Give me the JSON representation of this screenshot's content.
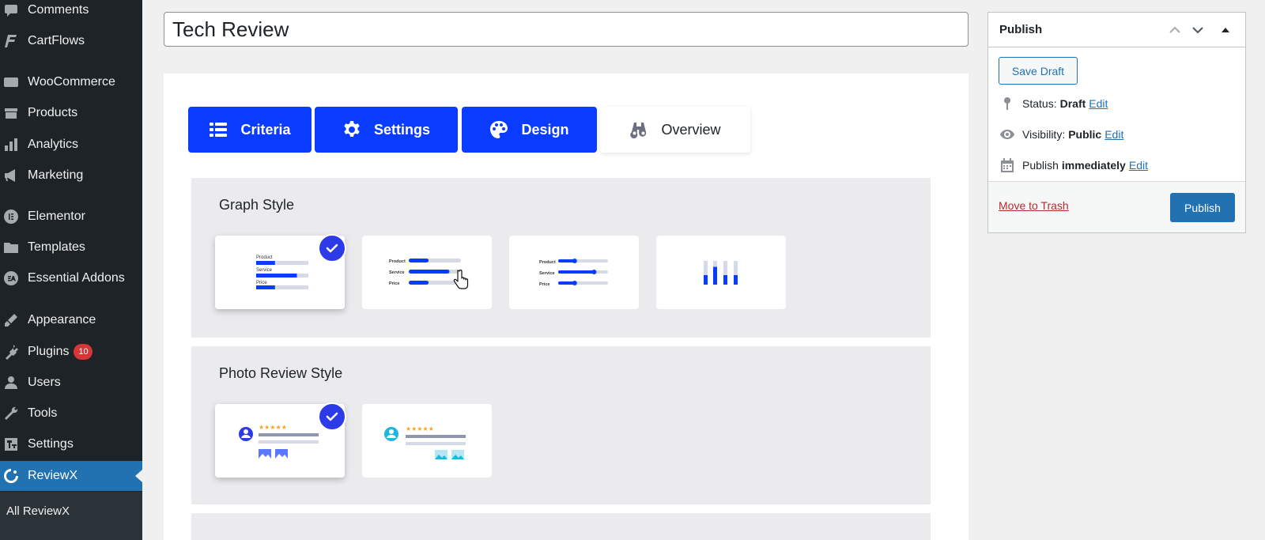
{
  "sidebar": {
    "items": [
      {
        "label": "Comments",
        "icon": "comments-icon"
      },
      {
        "label": "CartFlows",
        "icon": "cartflows-icon"
      },
      {
        "label": "WooCommerce",
        "icon": "woocommerce-icon"
      },
      {
        "label": "Products",
        "icon": "products-icon"
      },
      {
        "label": "Analytics",
        "icon": "analytics-icon"
      },
      {
        "label": "Marketing",
        "icon": "marketing-icon"
      },
      {
        "label": "Elementor",
        "icon": "elementor-icon"
      },
      {
        "label": "Templates",
        "icon": "templates-icon"
      },
      {
        "label": "Essential Addons",
        "icon": "essential-addons-icon"
      },
      {
        "label": "Appearance",
        "icon": "appearance-icon"
      },
      {
        "label": "Plugins",
        "icon": "plugins-icon",
        "badge": "10"
      },
      {
        "label": "Users",
        "icon": "users-icon"
      },
      {
        "label": "Tools",
        "icon": "tools-icon"
      },
      {
        "label": "Settings",
        "icon": "settings-icon"
      },
      {
        "label": "ReviewX",
        "icon": "reviewx-icon",
        "active": true
      }
    ],
    "submenu": {
      "label": "All ReviewX"
    }
  },
  "post": {
    "title": "Tech Review"
  },
  "tabs": [
    {
      "label": "Criteria",
      "icon": "list-icon"
    },
    {
      "label": "Settings",
      "icon": "gear-icon"
    },
    {
      "label": "Design",
      "icon": "palette-icon"
    },
    {
      "label": "Overview",
      "icon": "binoculars-icon"
    }
  ],
  "graph_style": {
    "title": "Graph Style",
    "options": [
      {
        "name": "style-1",
        "selected": true,
        "labels": [
          "Product",
          "Service",
          "Price"
        ],
        "fill": [
          0.36,
          0.78,
          0.36
        ]
      },
      {
        "name": "style-2",
        "selected": false,
        "labels": [
          "Product",
          "Service",
          "Price"
        ],
        "fill": [
          0.38,
          0.78,
          0.38
        ]
      },
      {
        "name": "style-3",
        "selected": false,
        "labels": [
          "Product",
          "Service",
          "Price"
        ],
        "fill": [
          0.33,
          0.72,
          0.33
        ]
      },
      {
        "name": "style-4",
        "selected": false,
        "fill": [
          0.4,
          0.75,
          0.4,
          0.4
        ]
      }
    ]
  },
  "photo_review_style": {
    "title": "Photo Review Style",
    "options": [
      {
        "name": "photo-style-1",
        "selected": true,
        "stars": "★★★★★"
      },
      {
        "name": "photo-style-2",
        "selected": false,
        "stars": "★★★★★"
      }
    ]
  },
  "publish": {
    "title": "Publish",
    "save_draft": "Save Draft",
    "status_label": "Status:",
    "status_value": "Draft",
    "visibility_label": "Visibility:",
    "visibility_value": "Public",
    "schedule_label": "Publish",
    "schedule_value": "immediately",
    "edit": "Edit",
    "trash": "Move to Trash",
    "button": "Publish"
  },
  "colors": {
    "sidebar_bg": "#1d2327",
    "active_menu": "#2271b1",
    "tab_primary": "#0a3cff",
    "bar_blue": "#0a3cff",
    "bar_track": "#d6dae6",
    "check": "#2d3ae8"
  }
}
